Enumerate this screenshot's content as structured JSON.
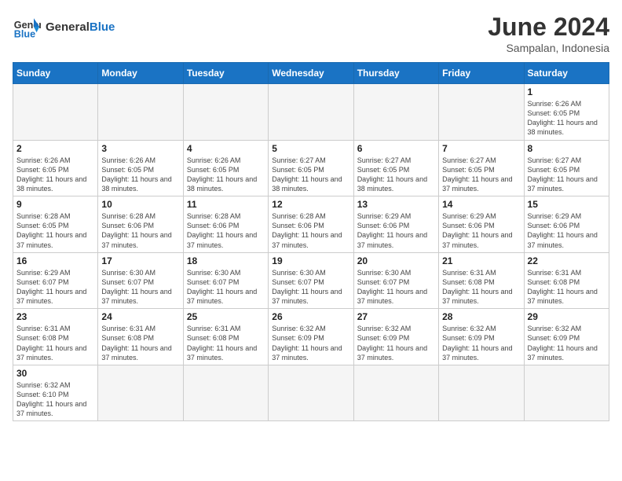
{
  "logo": {
    "general": "General",
    "blue": "Blue"
  },
  "title": "June 2024",
  "subtitle": "Sampalan, Indonesia",
  "days_header": [
    "Sunday",
    "Monday",
    "Tuesday",
    "Wednesday",
    "Thursday",
    "Friday",
    "Saturday"
  ],
  "weeks": [
    [
      {
        "day": "",
        "info": ""
      },
      {
        "day": "",
        "info": ""
      },
      {
        "day": "",
        "info": ""
      },
      {
        "day": "",
        "info": ""
      },
      {
        "day": "",
        "info": ""
      },
      {
        "day": "",
        "info": ""
      },
      {
        "day": "1",
        "info": "Sunrise: 6:26 AM\nSunset: 6:05 PM\nDaylight: 11 hours and 38 minutes."
      }
    ],
    [
      {
        "day": "2",
        "info": "Sunrise: 6:26 AM\nSunset: 6:05 PM\nDaylight: 11 hours and 38 minutes."
      },
      {
        "day": "3",
        "info": "Sunrise: 6:26 AM\nSunset: 6:05 PM\nDaylight: 11 hours and 38 minutes."
      },
      {
        "day": "4",
        "info": "Sunrise: 6:26 AM\nSunset: 6:05 PM\nDaylight: 11 hours and 38 minutes."
      },
      {
        "day": "5",
        "info": "Sunrise: 6:27 AM\nSunset: 6:05 PM\nDaylight: 11 hours and 38 minutes."
      },
      {
        "day": "6",
        "info": "Sunrise: 6:27 AM\nSunset: 6:05 PM\nDaylight: 11 hours and 38 minutes."
      },
      {
        "day": "7",
        "info": "Sunrise: 6:27 AM\nSunset: 6:05 PM\nDaylight: 11 hours and 37 minutes."
      },
      {
        "day": "8",
        "info": "Sunrise: 6:27 AM\nSunset: 6:05 PM\nDaylight: 11 hours and 37 minutes."
      }
    ],
    [
      {
        "day": "9",
        "info": "Sunrise: 6:28 AM\nSunset: 6:05 PM\nDaylight: 11 hours and 37 minutes."
      },
      {
        "day": "10",
        "info": "Sunrise: 6:28 AM\nSunset: 6:06 PM\nDaylight: 11 hours and 37 minutes."
      },
      {
        "day": "11",
        "info": "Sunrise: 6:28 AM\nSunset: 6:06 PM\nDaylight: 11 hours and 37 minutes."
      },
      {
        "day": "12",
        "info": "Sunrise: 6:28 AM\nSunset: 6:06 PM\nDaylight: 11 hours and 37 minutes."
      },
      {
        "day": "13",
        "info": "Sunrise: 6:29 AM\nSunset: 6:06 PM\nDaylight: 11 hours and 37 minutes."
      },
      {
        "day": "14",
        "info": "Sunrise: 6:29 AM\nSunset: 6:06 PM\nDaylight: 11 hours and 37 minutes."
      },
      {
        "day": "15",
        "info": "Sunrise: 6:29 AM\nSunset: 6:06 PM\nDaylight: 11 hours and 37 minutes."
      }
    ],
    [
      {
        "day": "16",
        "info": "Sunrise: 6:29 AM\nSunset: 6:07 PM\nDaylight: 11 hours and 37 minutes."
      },
      {
        "day": "17",
        "info": "Sunrise: 6:30 AM\nSunset: 6:07 PM\nDaylight: 11 hours and 37 minutes."
      },
      {
        "day": "18",
        "info": "Sunrise: 6:30 AM\nSunset: 6:07 PM\nDaylight: 11 hours and 37 minutes."
      },
      {
        "day": "19",
        "info": "Sunrise: 6:30 AM\nSunset: 6:07 PM\nDaylight: 11 hours and 37 minutes."
      },
      {
        "day": "20",
        "info": "Sunrise: 6:30 AM\nSunset: 6:07 PM\nDaylight: 11 hours and 37 minutes."
      },
      {
        "day": "21",
        "info": "Sunrise: 6:31 AM\nSunset: 6:08 PM\nDaylight: 11 hours and 37 minutes."
      },
      {
        "day": "22",
        "info": "Sunrise: 6:31 AM\nSunset: 6:08 PM\nDaylight: 11 hours and 37 minutes."
      }
    ],
    [
      {
        "day": "23",
        "info": "Sunrise: 6:31 AM\nSunset: 6:08 PM\nDaylight: 11 hours and 37 minutes."
      },
      {
        "day": "24",
        "info": "Sunrise: 6:31 AM\nSunset: 6:08 PM\nDaylight: 11 hours and 37 minutes."
      },
      {
        "day": "25",
        "info": "Sunrise: 6:31 AM\nSunset: 6:08 PM\nDaylight: 11 hours and 37 minutes."
      },
      {
        "day": "26",
        "info": "Sunrise: 6:32 AM\nSunset: 6:09 PM\nDaylight: 11 hours and 37 minutes."
      },
      {
        "day": "27",
        "info": "Sunrise: 6:32 AM\nSunset: 6:09 PM\nDaylight: 11 hours and 37 minutes."
      },
      {
        "day": "28",
        "info": "Sunrise: 6:32 AM\nSunset: 6:09 PM\nDaylight: 11 hours and 37 minutes."
      },
      {
        "day": "29",
        "info": "Sunrise: 6:32 AM\nSunset: 6:09 PM\nDaylight: 11 hours and 37 minutes."
      }
    ],
    [
      {
        "day": "30",
        "info": "Sunrise: 6:32 AM\nSunset: 6:10 PM\nDaylight: 11 hours and 37 minutes."
      },
      {
        "day": "",
        "info": ""
      },
      {
        "day": "",
        "info": ""
      },
      {
        "day": "",
        "info": ""
      },
      {
        "day": "",
        "info": ""
      },
      {
        "day": "",
        "info": ""
      },
      {
        "day": "",
        "info": ""
      }
    ]
  ]
}
